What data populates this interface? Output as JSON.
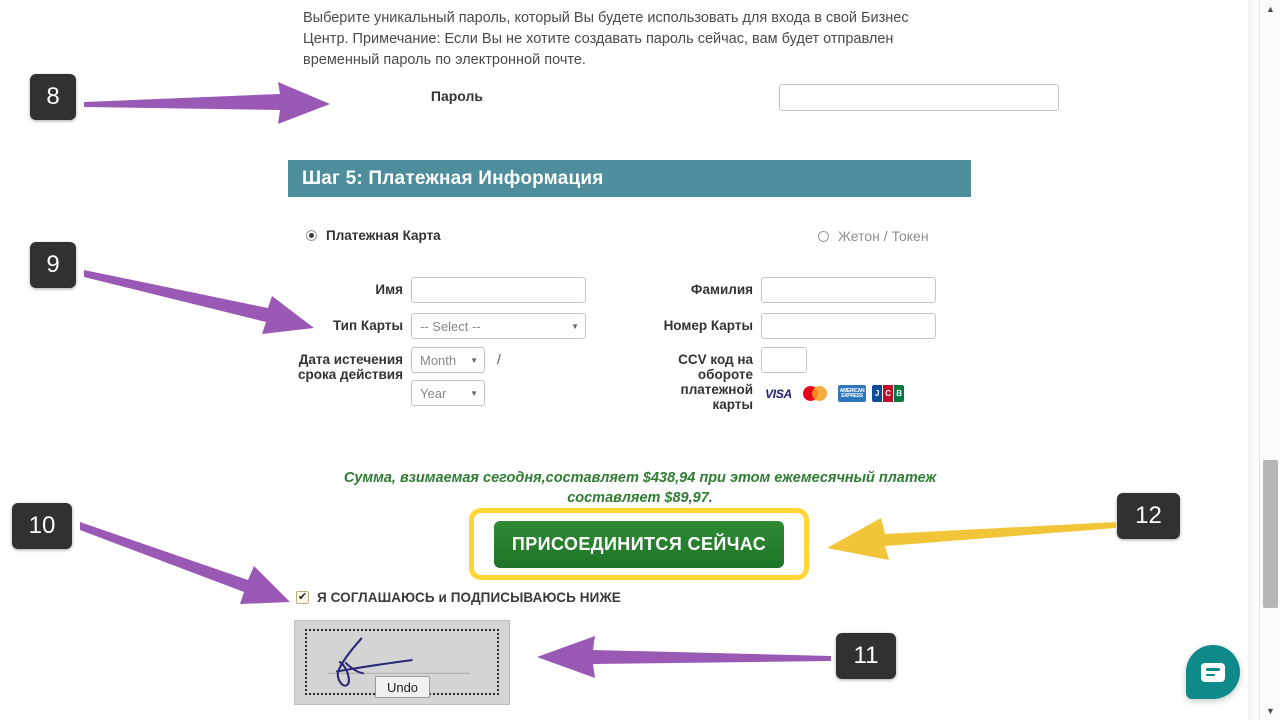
{
  "intro": {
    "paragraph": "Выберите уникальный пароль, который Вы будете использовать для входа в свой Бизнес Центр. Примечание: Если Вы не хотите создавать пароль сейчас, вам будет отправлен временный пароль по электронной почте."
  },
  "password": {
    "label": "Пароль",
    "value": "",
    "placeholder": ""
  },
  "step": {
    "title": "Шаг 5: Платежная Информация",
    "accent_color": "#4d8d9c"
  },
  "payment_methods": {
    "card_option": "Платежная Карта",
    "card_selected": true,
    "token_option": "Жетон / Токен",
    "token_selected": false
  },
  "card_form": {
    "first_name_label": "Имя",
    "first_name_value": "",
    "last_name_label": "Фамилия",
    "last_name_value": "",
    "card_type_label": "Тип Карты",
    "card_type_value": "-- Select --",
    "card_number_label": "Номер Карты",
    "card_number_value": "",
    "expiry_label_line1": "Дата истечения",
    "expiry_label_line2": "срока действия",
    "expiry_month_value": "Month",
    "expiry_year_value": "Year",
    "expiry_separator": "/",
    "ccv_label_line1": "CCV код на",
    "ccv_label_line2": "обороте",
    "ccv_label_line3": "платежной",
    "ccv_label_line4": "карты",
    "ccv_value": "",
    "accepted_cards": [
      "VISA",
      "Mastercard",
      "American Express",
      "JCB"
    ],
    "visa_text": "VISA",
    "amex_text_line1": "AMERICAN",
    "amex_text_line2": "EXPRESS",
    "jcb_letters": [
      "J",
      "C",
      "B"
    ]
  },
  "amount_note": {
    "line1": "Сумма, взимаемая сегодня,составляет $438,94 при этом ежемесячный платеж",
    "line2": "составляет $89,97.",
    "charged_today": "$438,94",
    "monthly_payment": "$89,97",
    "color": "#2e7d32"
  },
  "join": {
    "button_label": "ПРИСОЕДИНИТСЯ СЕЙЧАС",
    "button_color": "#2f8a33",
    "highlight_color": "#ffd633"
  },
  "agree": {
    "checked": true,
    "label": "Я СОГЛАШАЮСЬ и ПОДПИСЫВАЮСЬ НИЖЕ"
  },
  "signature": {
    "undo_label": "Undo",
    "ink_color": "#2a2a7a"
  },
  "annotations": {
    "badges": [
      {
        "id": "8",
        "label": "8",
        "arrow_color": "#9b59b6",
        "arrow_direction": "right"
      },
      {
        "id": "9",
        "label": "9",
        "arrow_color": "#9b59b6",
        "arrow_direction": "down-right"
      },
      {
        "id": "10",
        "label": "10",
        "arrow_color": "#9b59b6",
        "arrow_direction": "down-right"
      },
      {
        "id": "11",
        "label": "11",
        "arrow_color": "#9b59b6",
        "arrow_direction": "left"
      },
      {
        "id": "12",
        "label": "12",
        "arrow_color": "#f2c438",
        "arrow_direction": "left"
      }
    ],
    "purple": "#9b59b6",
    "yellow": "#f2c438"
  },
  "chat_widget": {
    "icon": "chat-bubble-icon",
    "color": "#0f8a8a"
  },
  "scrollbar": {
    "up_arrow": "▲",
    "down_arrow": "▼"
  }
}
